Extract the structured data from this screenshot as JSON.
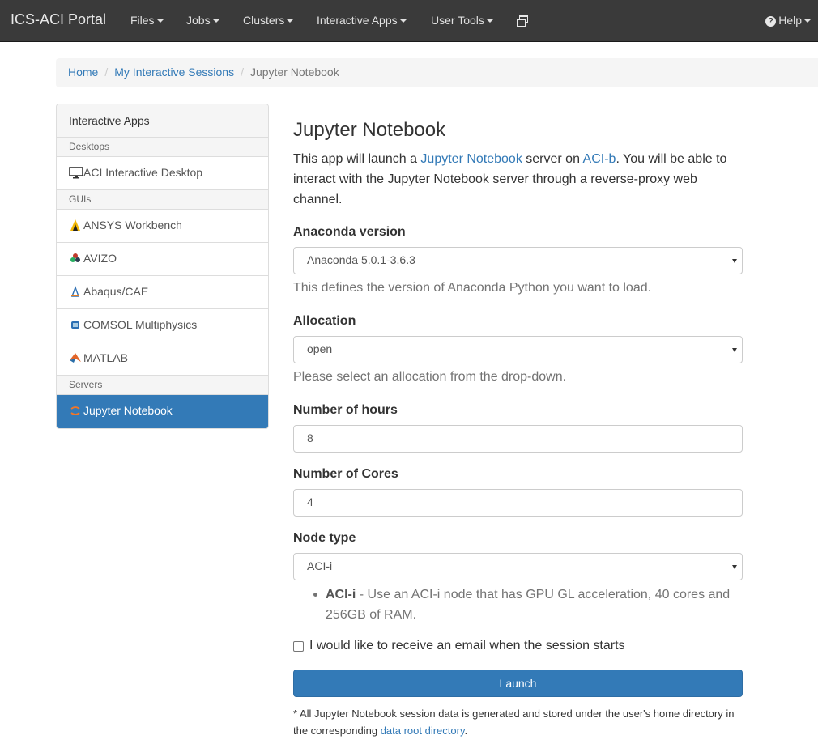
{
  "navbar": {
    "brand": "ICS-ACI Portal",
    "menus": [
      "Files",
      "Jobs",
      "Clusters",
      "Interactive Apps",
      "User Tools"
    ],
    "copy_icon": "windows-copy-icon",
    "help": "Help"
  },
  "breadcrumb": {
    "items": [
      "Home",
      "My Interactive Sessions"
    ],
    "active": "Jupyter Notebook"
  },
  "sidebar": {
    "heading": "Interactive Apps",
    "categories": [
      "Desktops",
      "GUIs",
      "Servers"
    ],
    "items": [
      {
        "label": "ACI Interactive Desktop",
        "icon": "monitor-icon"
      },
      {
        "label": "ANSYS Workbench",
        "icon": "ansys-icon"
      },
      {
        "label": "AVIZO",
        "icon": "avizo-icon"
      },
      {
        "label": "Abaqus/CAE",
        "icon": "abaqus-icon"
      },
      {
        "label": "COMSOL Multiphysics",
        "icon": "comsol-icon"
      },
      {
        "label": "MATLAB",
        "icon": "matlab-icon"
      },
      {
        "label": "Jupyter Notebook",
        "icon": "jupyter-icon",
        "active": true
      }
    ]
  },
  "form": {
    "title": "Jupyter Notebook",
    "intro_pre": "This app will launch a ",
    "intro_link1": "Jupyter Notebook",
    "intro_mid": " server on ",
    "intro_link2": "ACI-b",
    "intro_post": ". You will be able to interact with the Jupyter Notebook server through a reverse-proxy web channel.",
    "anaconda": {
      "label": "Anaconda version",
      "value": "Anaconda 5.0.1-3.6.3",
      "help": "This defines the version of Anaconda Python you want to load."
    },
    "allocation": {
      "label": "Allocation",
      "value": "open",
      "help": "Please select an allocation from the drop-down."
    },
    "hours": {
      "label": "Number of hours",
      "value": "8"
    },
    "cores": {
      "label": "Number of Cores",
      "value": "4"
    },
    "node_type": {
      "label": "Node type",
      "value": "ACI-i",
      "bullet_bold": "ACI-i",
      "bullet_text": " - Use an ACI-i node that has GPU GL acceleration, 40 cores and 256GB of RAM."
    },
    "email_checkbox": "I would like to receive an email when the session starts",
    "email_checked": false,
    "launch": "Launch",
    "footnote_pre": "* All Jupyter Notebook session data is generated and stored under the user's home directory in the corresponding ",
    "footnote_link": "data root directory",
    "footnote_post": "."
  },
  "colors": {
    "primary": "#337ab7",
    "navbar": "#3a3a3a"
  }
}
